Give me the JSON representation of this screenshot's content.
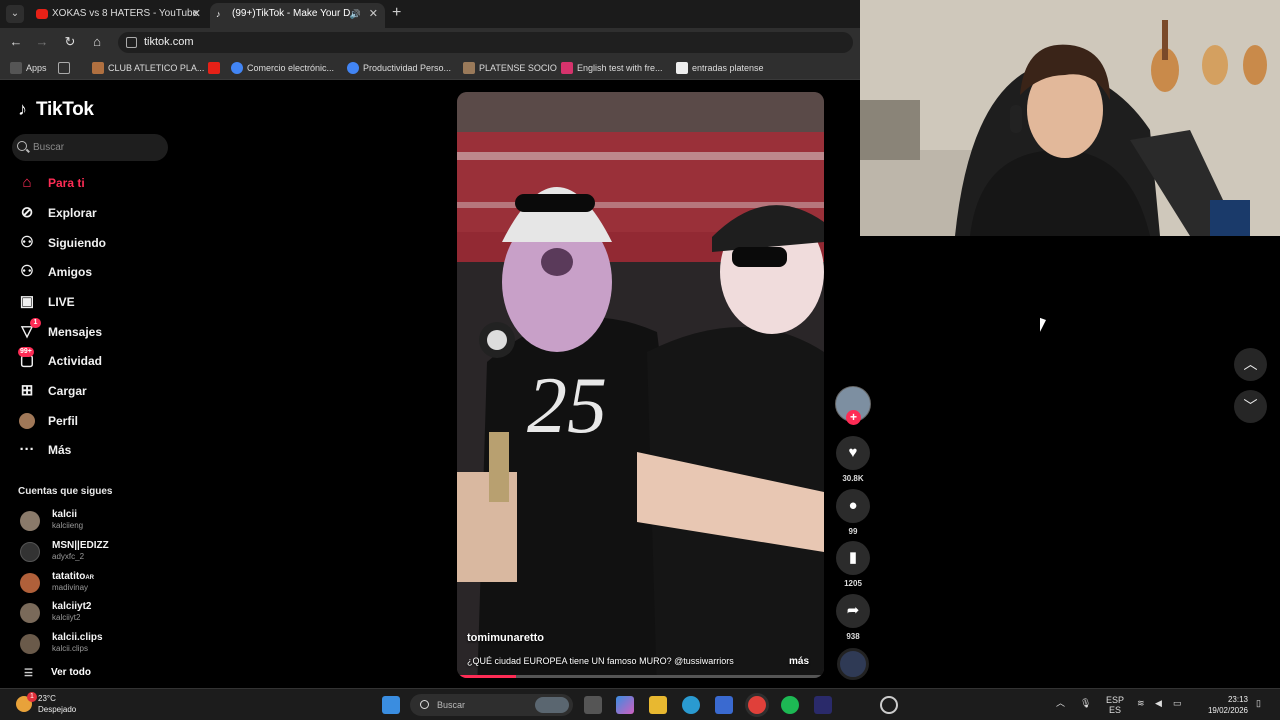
{
  "browser": {
    "tabs": [
      {
        "title": "XOKAS vs 8 HATERS - YouTube",
        "favicon_color": "#e62117"
      },
      {
        "title": "(99+)TikTok - Make Your D",
        "favicon_color": "#ffffff"
      }
    ],
    "url": "tiktok.com",
    "bookmarks": [
      {
        "label": "Apps",
        "color": "#555555"
      },
      {
        "label": "",
        "color": "#555555"
      },
      {
        "label": "CLUB ATLETICO PLA...",
        "color": "#b07040"
      },
      {
        "label": "",
        "color": "#e62117"
      },
      {
        "label": "Comercio electrónic...",
        "color": "#4285f4"
      },
      {
        "label": "Productividad Perso...",
        "color": "#4285f4"
      },
      {
        "label": "PLATENSE SOCIO",
        "color": "#9a7a5a"
      },
      {
        "label": "English test with fre...",
        "color": "#d6336c"
      },
      {
        "label": "entradas platense",
        "color": "#eeeeee"
      }
    ]
  },
  "tiktok": {
    "logo": "TikTok",
    "search_placeholder": "Buscar",
    "nav": [
      {
        "label": "Para ti",
        "icon": "home-icon",
        "glyph": "⌂"
      },
      {
        "label": "Explorar",
        "icon": "compass-icon",
        "glyph": "⊘"
      },
      {
        "label": "Siguiendo",
        "icon": "following-icon",
        "glyph": "⚇"
      },
      {
        "label": "Amigos",
        "icon": "friends-icon",
        "glyph": "⚇"
      },
      {
        "label": "LIVE",
        "icon": "live-icon",
        "glyph": "▣"
      },
      {
        "label": "Mensajes",
        "icon": "messages-icon",
        "glyph": "▽",
        "badge": "1"
      },
      {
        "label": "Actividad",
        "icon": "activity-icon",
        "glyph": "▢",
        "badge": "99+"
      },
      {
        "label": "Cargar",
        "icon": "upload-icon",
        "glyph": "⊞"
      },
      {
        "label": "Perfil",
        "icon": "profile-avatar-icon",
        "glyph": "●"
      },
      {
        "label": "Más",
        "icon": "more-icon",
        "glyph": "···"
      }
    ],
    "following_title": "Cuentas que sigues",
    "following": [
      {
        "name": "kalcii",
        "user": "kalciieng",
        "color": "#8a7a6a"
      },
      {
        "name": "MSN||EDIZZ",
        "user": "adyxfc_2",
        "color": "#333333"
      },
      {
        "name": "tatatito",
        "user": "madivinay",
        "color": "#b0603a"
      },
      {
        "name": "kalciiyt2",
        "user": "kalciiyt2",
        "color": "#7a6a5a"
      },
      {
        "name": "kalcii.clips",
        "user": "kalcii.clips",
        "color": "#6a5a4a"
      }
    ],
    "following_badge": "AR",
    "see_all": "Ver todo",
    "video": {
      "author": "tomimunaretto",
      "description": "¿QUÉ ciudad EUROPEA tiene UN famoso MURO? @tussiwarriors",
      "more": "más",
      "jersey_number": "25",
      "progress": 0.16
    },
    "actions": {
      "likes": "30.8K",
      "comments": "99",
      "saves": "1205",
      "shares": "938"
    }
  },
  "taskbar": {
    "temperature": "23°C",
    "condition": "Despejado",
    "search_placeholder": "Buscar",
    "language_top": "ESP",
    "language_bottom": "ES",
    "time": "23:13",
    "date": "19/02/2026"
  }
}
